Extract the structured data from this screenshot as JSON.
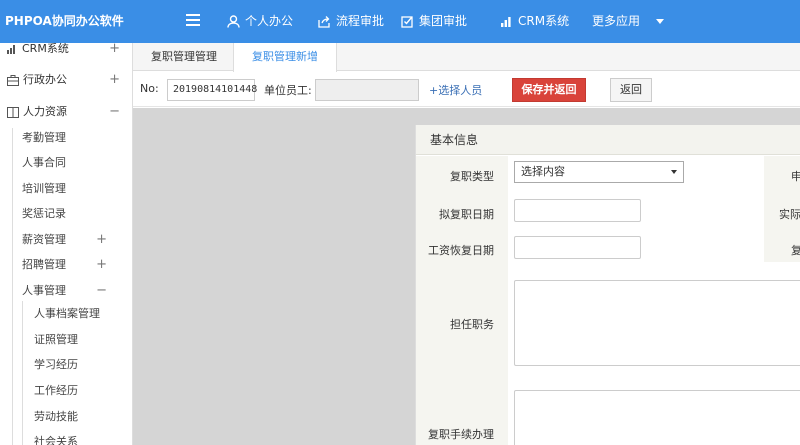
{
  "app": {
    "title": "PHPOA协同办公软件"
  },
  "topnav": {
    "items": [
      {
        "label": "个人办公",
        "icon": "user-icon"
      },
      {
        "label": "流程审批",
        "icon": "share-icon"
      },
      {
        "label": "集团审批",
        "icon": "checkbox-icon"
      },
      {
        "label": "CRM系统",
        "icon": "bar-chart-icon"
      },
      {
        "label": "更多应用",
        "icon": "chevron-down-icon"
      }
    ]
  },
  "sidebar": {
    "items": [
      {
        "label": "CRM系统",
        "sign": "+"
      },
      {
        "label": "行政办公",
        "sign": "+"
      },
      {
        "label": "人力资源",
        "sign": "−"
      },
      {
        "label": "考勤管理"
      },
      {
        "label": "人事合同"
      },
      {
        "label": "培训管理"
      },
      {
        "label": "奖惩记录"
      },
      {
        "label": "薪资管理",
        "sign": "+"
      },
      {
        "label": "招聘管理",
        "sign": "+"
      },
      {
        "label": "人事管理",
        "sign": "−"
      },
      {
        "label": "人事档案管理"
      },
      {
        "label": "证照管理"
      },
      {
        "label": "学习经历"
      },
      {
        "label": "工作经历"
      },
      {
        "label": "劳动技能"
      },
      {
        "label": "社会关系"
      }
    ]
  },
  "tabs": [
    {
      "label": "复职管理管理"
    },
    {
      "label": "复职管理新增"
    }
  ],
  "toolbar": {
    "no_label": "No:",
    "no_value": "20190814101448",
    "employee_label": "单位员工:",
    "employee_value": "",
    "select_person": "+选择人员",
    "save_return": "保存并返回",
    "back": "返回"
  },
  "form": {
    "section_title": "基本信息",
    "type_label": "复职类型",
    "type_selected": "选择内容",
    "planned_date_label": "拟复职日期",
    "salary_date_label": "工资恢复日期",
    "position_label": "担任职务",
    "procedure_label": "复职手续办理",
    "right_col_labels": [
      "申",
      "实际",
      "复"
    ]
  },
  "colors": {
    "topbar": "#3a8ee6",
    "accent_button": "#d9433a",
    "tab_active": "#3a8ee6"
  }
}
